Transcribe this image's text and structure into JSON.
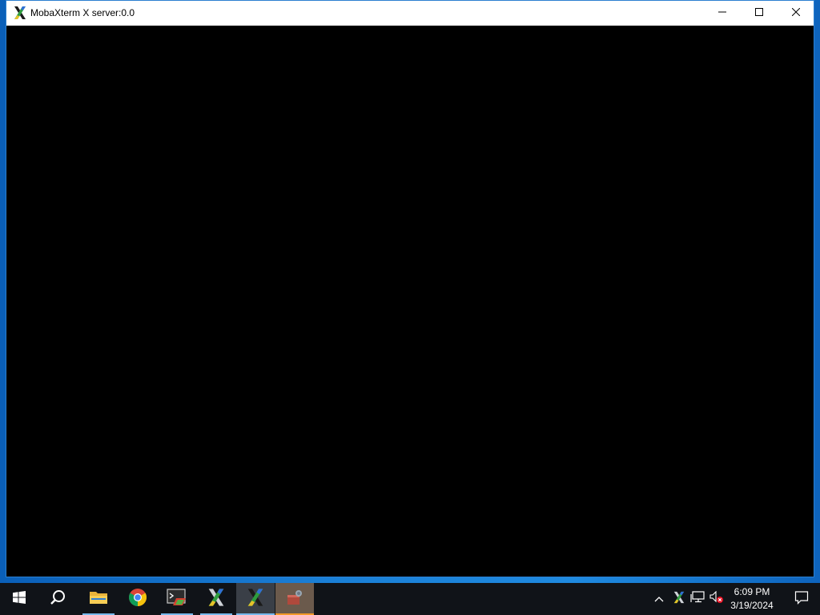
{
  "window": {
    "title": "MobaXterm X server:0.0",
    "controls": {
      "minimize_icon": "minimize-icon",
      "maximize_icon": "maximize-icon",
      "close_icon": "close-icon"
    }
  },
  "taskbar": {
    "apps": [
      {
        "name": "start-button",
        "icon": "windows-logo-icon"
      },
      {
        "name": "search-button",
        "icon": "search-icon"
      },
      {
        "name": "file-explorer",
        "icon": "folder-icon"
      },
      {
        "name": "chrome",
        "icon": "chrome-icon"
      },
      {
        "name": "terminal-app",
        "icon": "terminal-icon"
      },
      {
        "name": "mobaxterm",
        "icon": "mobaxterm-icon"
      },
      {
        "name": "mobaxterm-x-server",
        "icon": "mobaxterm-icon"
      },
      {
        "name": "archive-app",
        "icon": "package-icon"
      }
    ],
    "tray": {
      "overflow_icon": "chevron-up-icon",
      "x_server_icon": "mobaxterm-icon",
      "network_icon": "network-icon",
      "volume_icon": "volume-muted-icon",
      "time": "6:09 PM",
      "date": "3/19/2024",
      "notification_icon": "notification-icon"
    }
  },
  "colors": {
    "desktop": "#1a7fd6",
    "taskbar": "#101318",
    "accent": "#76b9ed",
    "client_area": "#000000"
  }
}
